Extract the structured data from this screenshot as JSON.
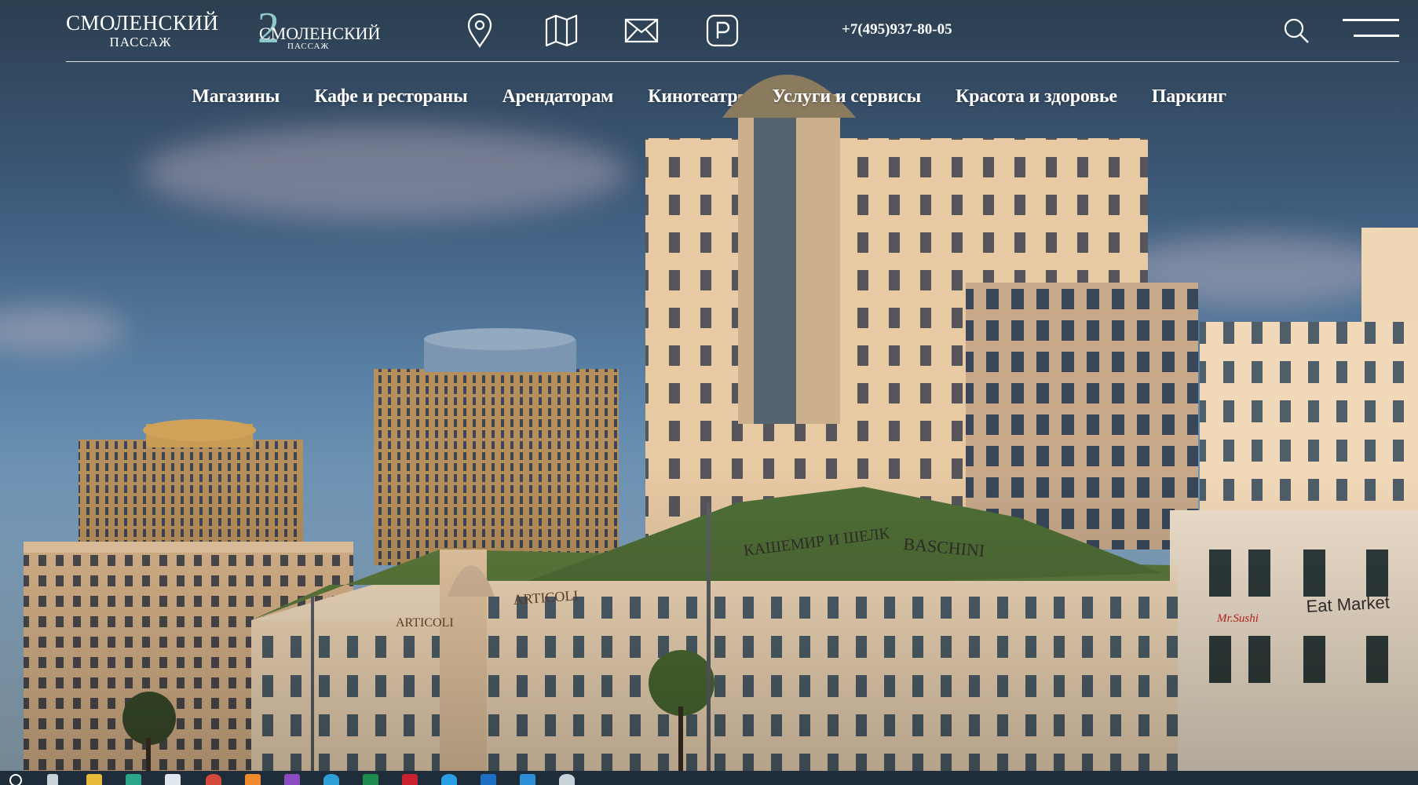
{
  "header": {
    "logo_main_line1": "СМОЛЕНСКИЙ",
    "logo_main_line2": "ПАССАЖ",
    "logo_second_number": "2",
    "logo_second_line1": "СМОЛЕНСКИЙ",
    "logo_second_line2": "ПАССАЖ",
    "phone": "+7(495)937-80-05",
    "icons": [
      "location-pin-icon",
      "map-icon",
      "mail-icon",
      "parking-icon",
      "search-icon",
      "menu-icon"
    ]
  },
  "nav": {
    "items": [
      "Магазины",
      "Кафе и рестораны",
      "Арендаторам",
      "Кинотеатр",
      "Услуги и сервисы",
      "Красота и здоровье",
      "Паркинг"
    ]
  },
  "hero": {
    "signs": [
      "КАШЕМИР И ШЕЛК",
      "BASCHINI",
      "ARTICOLI",
      "ARTICOLI",
      "Eat Market",
      "Mr.Sushi"
    ]
  },
  "colors": {
    "accent_teal": "#8fc9c9",
    "text": "#ffffff"
  }
}
